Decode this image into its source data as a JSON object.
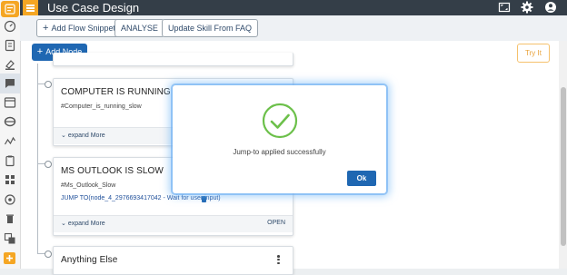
{
  "app": {
    "title": "Use Case Design"
  },
  "toolbar": {
    "add_flow_snippet": "Add Flow Snippet",
    "analyse": "ANALYSE",
    "update_skill": "Update Skill From FAQ"
  },
  "canvas": {
    "add_node": "Add Node",
    "try_it": "Try It"
  },
  "nodes": [
    {
      "title": "COMPUTER IS RUNNING SLOW",
      "tag": "#Computer_is_running_slow",
      "expand": "expand More"
    },
    {
      "title": "MS OUTLOOK IS SLOW",
      "tag": "#Ms_Outlook_Slow",
      "jump": "JUMP TO(node_4_2976693417042 - Wait for user input)",
      "expand": "expand More",
      "status": "OPEN"
    },
    {
      "title": "Anything Else"
    }
  ],
  "dialog": {
    "message": "Jump-to applied successfully",
    "ok": "Ok"
  },
  "colors": {
    "accent": "#f5a623",
    "topbar": "#343e48",
    "primary_button": "#1f67b2",
    "success": "#5cb85c"
  },
  "icons": {
    "rail": [
      "dashboard-icon",
      "document-icon",
      "paint-icon",
      "chat-icon",
      "browser-icon",
      "database-icon",
      "analytics-icon",
      "clipboard-icon",
      "apps-icon",
      "settings-icon",
      "trash-icon",
      "translate-icon",
      "add-icon"
    ],
    "topbar": [
      "fullscreen-icon",
      "settings-gear-icon",
      "account-icon"
    ]
  }
}
